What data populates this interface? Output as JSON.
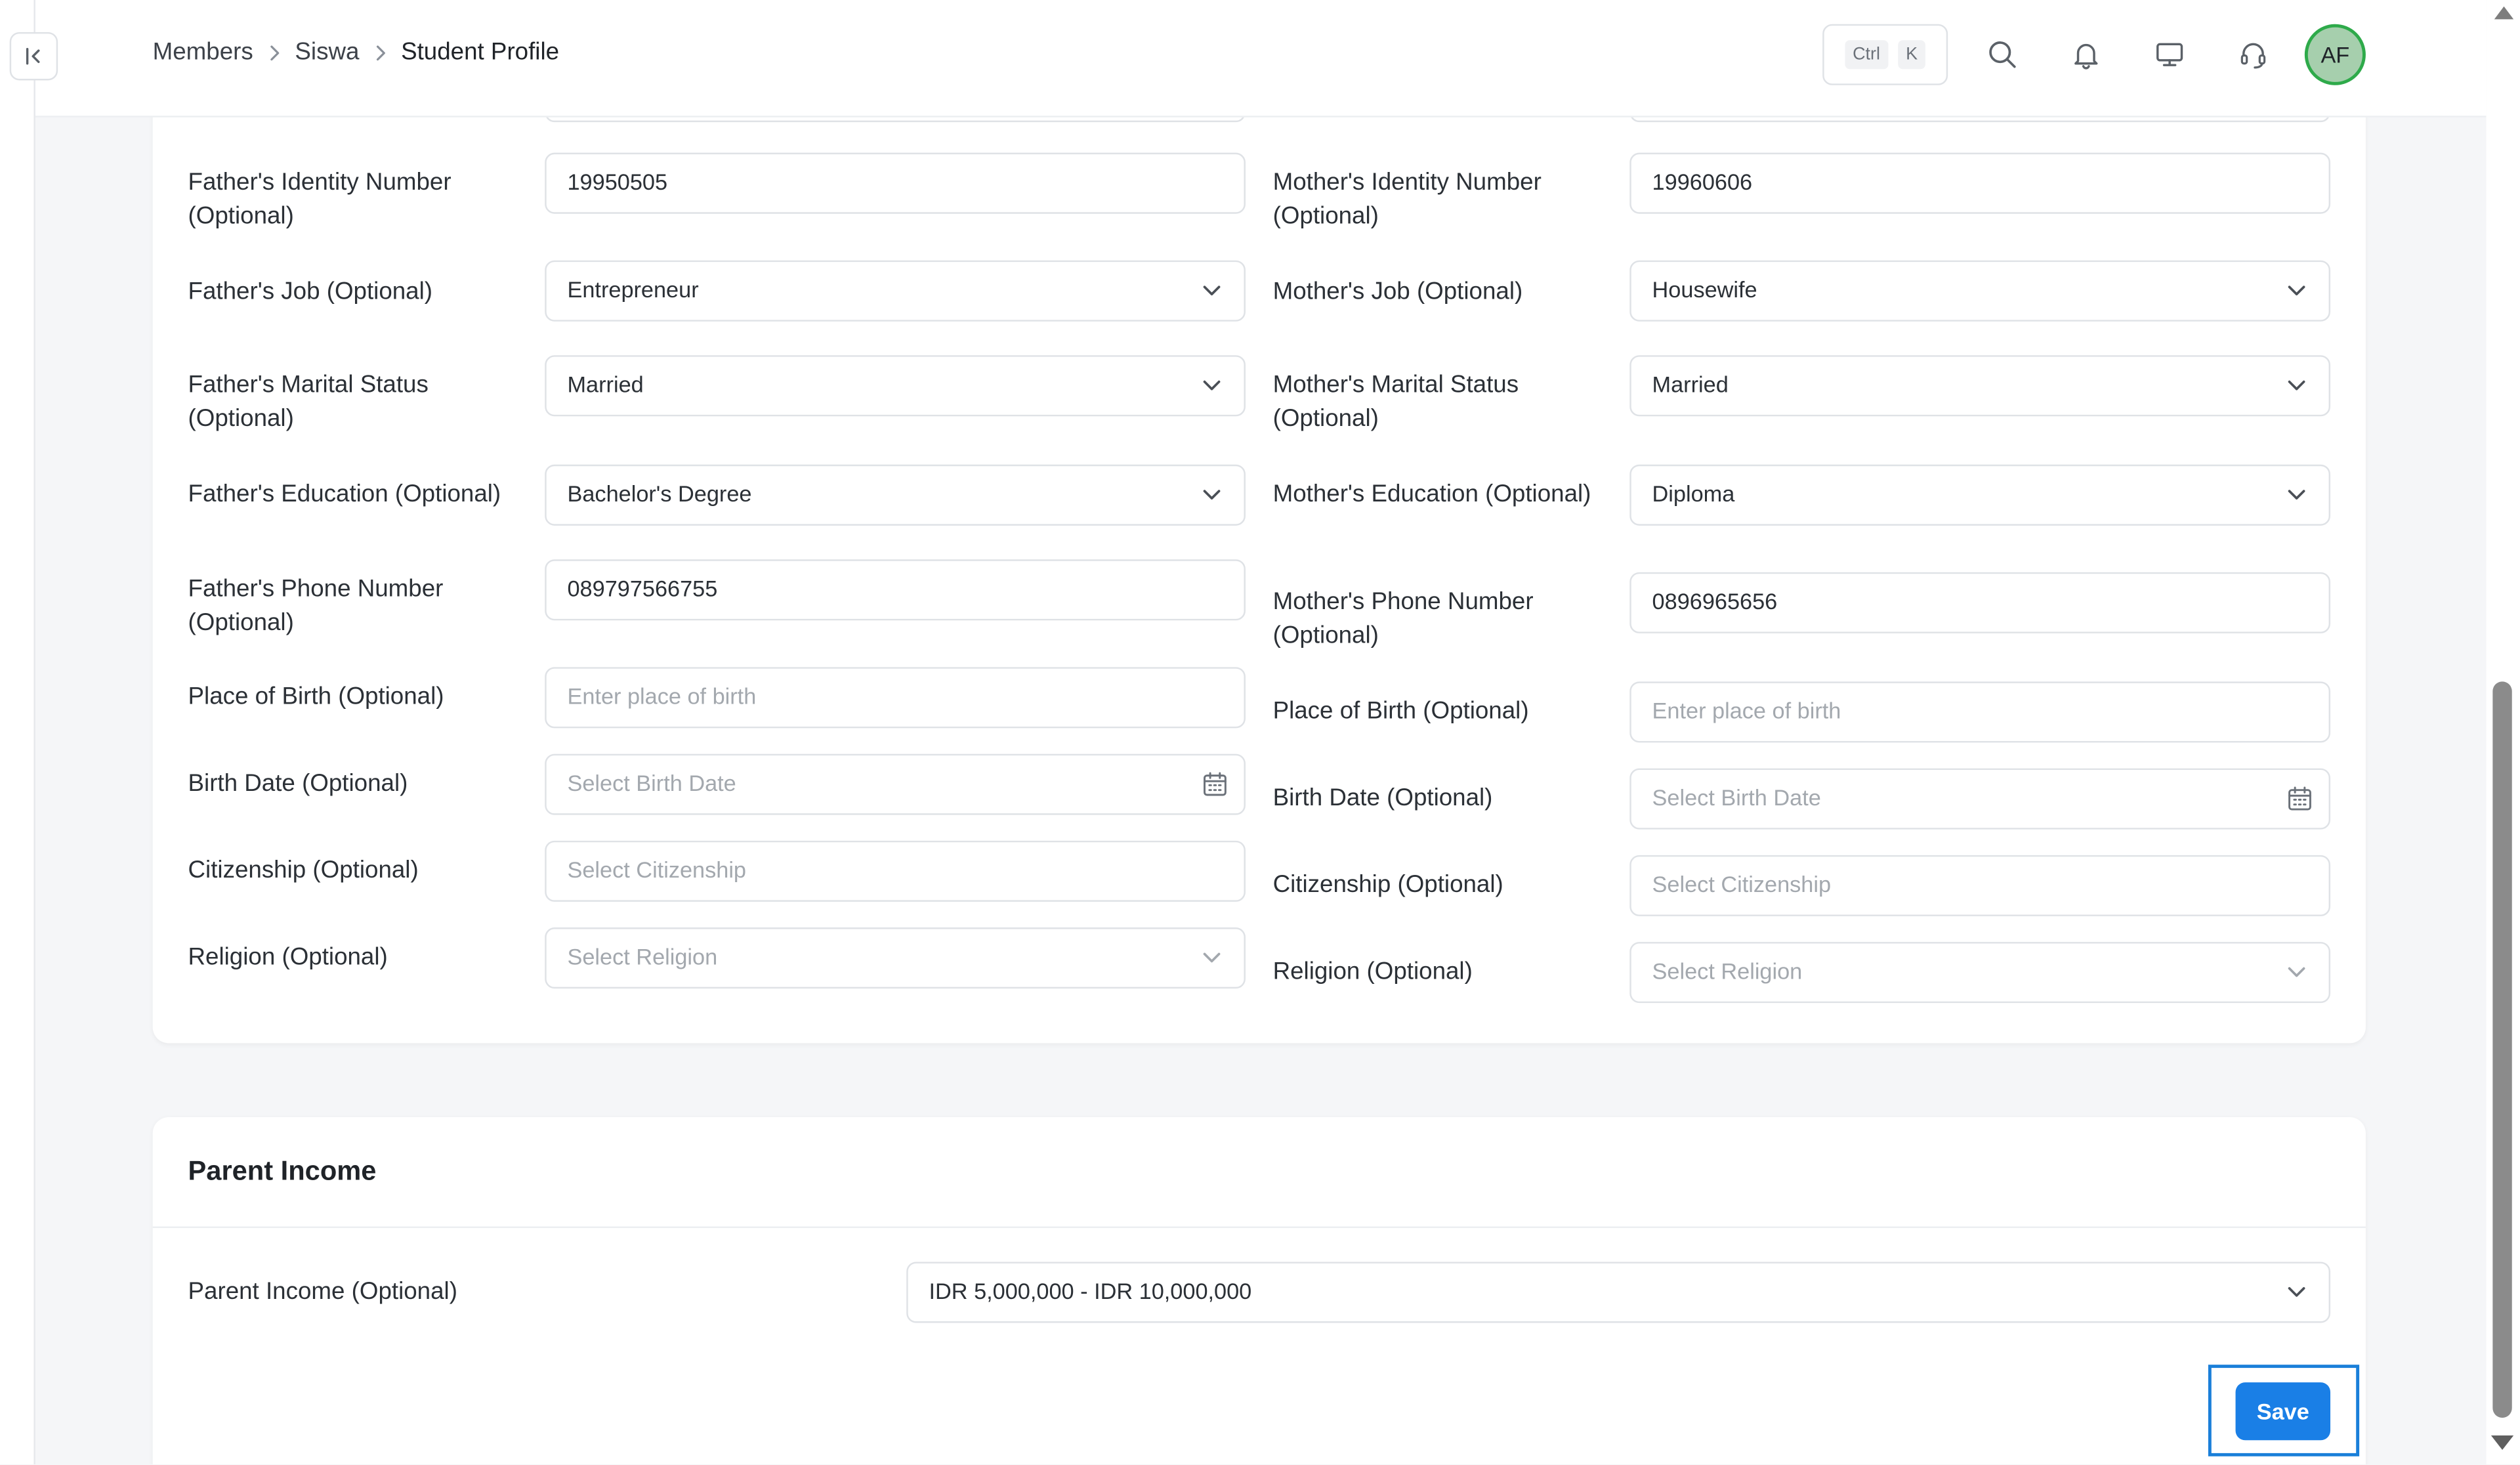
{
  "breadcrumb": [
    "Members",
    "Siswa",
    "Student Profile"
  ],
  "header": {
    "kbd_ctrl": "Ctrl",
    "kbd_k": "K",
    "avatar_initials": "AF",
    "avatar_color": "#a6cfad",
    "avatar_border": "#2eaa4a"
  },
  "father": {
    "identity": {
      "label": "Father's Identity Number (Optional)",
      "value": "19950505"
    },
    "job": {
      "label": "Father's Job (Optional)",
      "value": "Entrepreneur"
    },
    "marital": {
      "label": "Father's Marital Status (Optional)",
      "value": "Married"
    },
    "education": {
      "label": "Father's Education (Optional)",
      "value": "Bachelor's Degree"
    },
    "phone": {
      "label": "Father's Phone Number (Optional)",
      "value": "089797566755"
    },
    "birthplace": {
      "label": "Place of Birth (Optional)",
      "placeholder": "Enter place of birth"
    },
    "birthdate": {
      "label": "Birth Date (Optional)",
      "placeholder": "Select Birth Date"
    },
    "citizenship": {
      "label": "Citizenship (Optional)",
      "placeholder": "Select Citizenship"
    },
    "religion": {
      "label": "Religion (Optional)",
      "placeholder": "Select Religion"
    }
  },
  "mother": {
    "identity": {
      "label": "Mother's Identity Number (Optional)",
      "value": "19960606"
    },
    "job": {
      "label": "Mother's Job (Optional)",
      "value": "Housewife"
    },
    "marital": {
      "label": "Mother's Marital Status (Optional)",
      "value": "Married"
    },
    "education": {
      "label": "Mother's Education (Optional)",
      "value": "Diploma"
    },
    "phone": {
      "label": "Mother's Phone Number (Optional)",
      "value": "0896965656"
    },
    "birthplace": {
      "label": "Place of Birth (Optional)",
      "placeholder": "Enter place of birth"
    },
    "birthdate": {
      "label": "Birth Date (Optional)",
      "placeholder": "Select Birth Date"
    },
    "citizenship": {
      "label": "Citizenship (Optional)",
      "placeholder": "Select Citizenship"
    },
    "religion": {
      "label": "Religion (Optional)",
      "placeholder": "Select Religion"
    }
  },
  "parent_income": {
    "section_title": "Parent Income",
    "label": "Parent Income (Optional)",
    "value": "IDR 5,000,000 - IDR 10,000,000"
  },
  "actions": {
    "save_label": "Save",
    "accent": "#1a7fe6"
  }
}
